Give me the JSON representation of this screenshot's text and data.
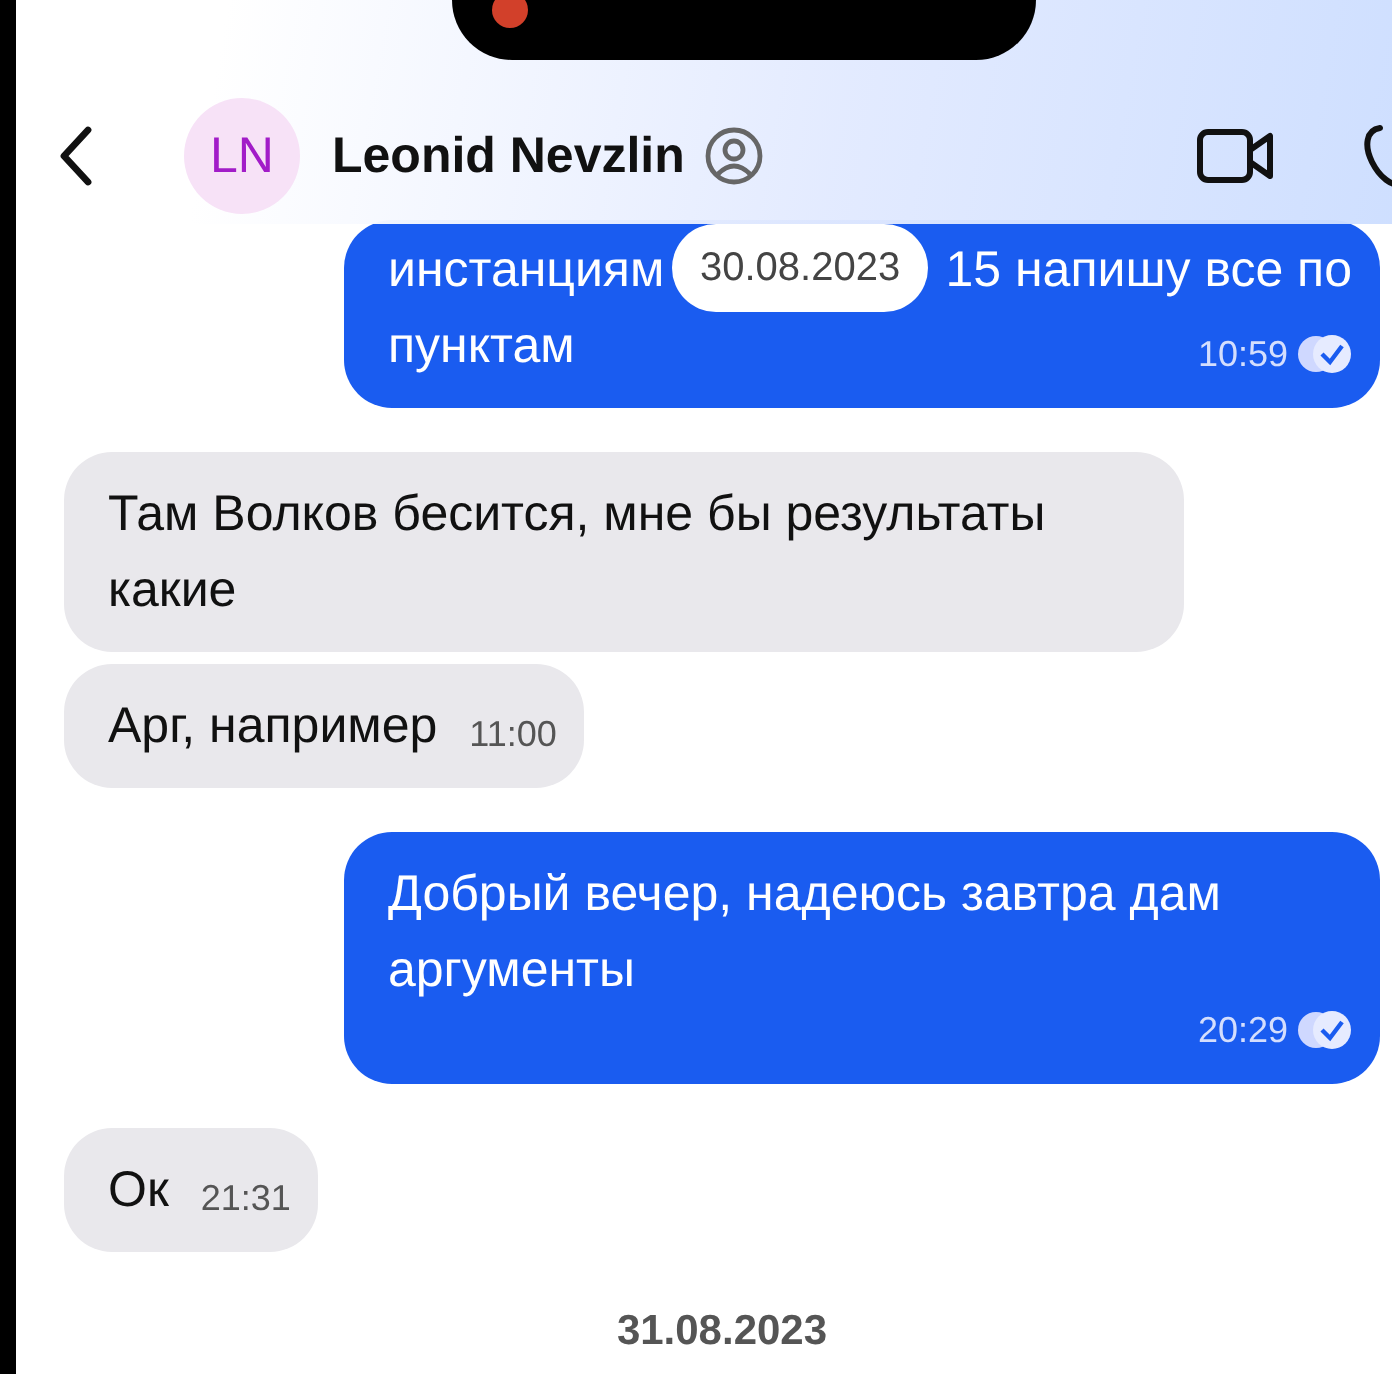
{
  "header": {
    "avatar_initials": "LN",
    "contact_name": "Leonid Nevzlin"
  },
  "feed": [
    {
      "kind": "outgoing",
      "lines": [
        "инстанциям",
        "15 напишу все по",
        "пунктам"
      ],
      "time": "10:59",
      "read": true,
      "date_overlay": "30.08.2023"
    },
    {
      "kind": "incoming",
      "text": "Там Волков бесится, мне бы результаты какие"
    },
    {
      "kind": "incoming",
      "text": "Арг, например",
      "time": "11:00"
    },
    {
      "kind": "outgoing",
      "text": "Добрый вечер, надеюсь завтра дам аргументы",
      "time": "20:29",
      "read": true
    },
    {
      "kind": "incoming",
      "text": "Ок",
      "time": "21:31"
    },
    {
      "kind": "date",
      "text": "31.08.2023"
    }
  ]
}
